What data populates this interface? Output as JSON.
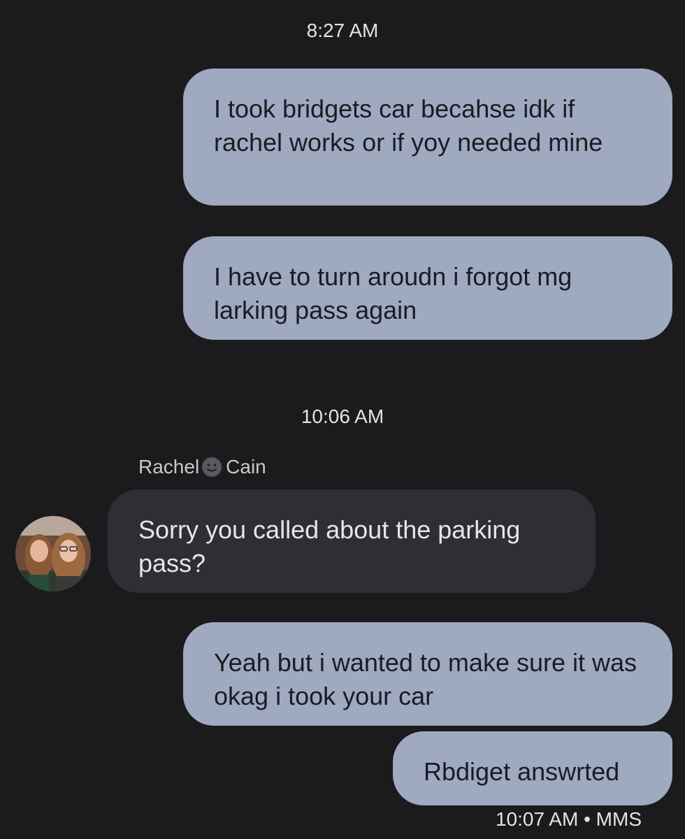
{
  "timestamps": {
    "first": "8:27 AM",
    "second": "10:06 AM"
  },
  "messages": [
    {
      "direction": "outgoing",
      "text": "I took bridgets car becahse idk if rachel works or if yoy needed mine"
    },
    {
      "direction": "outgoing",
      "text": "I have to turn aroudn i forgot mg larking pass again"
    },
    {
      "direction": "incoming",
      "text": "Sorry you called about the parking pass?"
    },
    {
      "direction": "outgoing",
      "text": "Yeah but i wanted to make sure it was okag i took your car"
    },
    {
      "direction": "outgoing",
      "text": "Rbdiget answrted"
    }
  ],
  "sender": {
    "first_name": "Rachel",
    "last_name": "Cain",
    "name_icon": "smiley-face-icon"
  },
  "last_status": {
    "time": "10:07 AM",
    "type": "MMS"
  },
  "colors": {
    "background": "#1b1b1e",
    "outgoing_bubble": "#9fa9c0",
    "incoming_bubble": "#2d2f34"
  }
}
